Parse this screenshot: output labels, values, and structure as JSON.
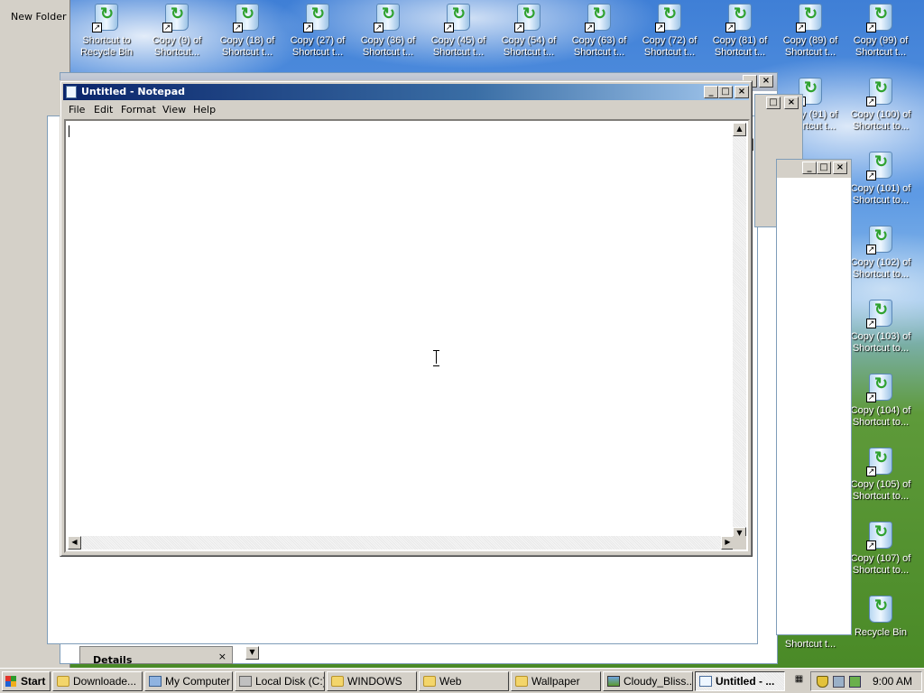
{
  "desktop": {
    "new_folder_label": "New Folder",
    "top_icons": [
      {
        "line1": "Shortcut to",
        "line2": "Recycle Bin"
      },
      {
        "line1": "Copy (9) of",
        "line2": "Shortcut..."
      },
      {
        "line1": "Copy (18) of",
        "line2": "Shortcut t..."
      },
      {
        "line1": "Copy (27) of",
        "line2": "Shortcut t..."
      },
      {
        "line1": "Copy (36) of",
        "line2": "Shortcut t..."
      },
      {
        "line1": "Copy (45) of",
        "line2": "Shortcut t..."
      },
      {
        "line1": "Copy (54) of",
        "line2": "Shortcut t..."
      },
      {
        "line1": "Copy (63) of",
        "line2": "Shortcut t..."
      },
      {
        "line1": "Copy (72) of",
        "line2": "Shortcut t..."
      },
      {
        "line1": "Copy (81) of",
        "line2": "Shortcut t..."
      },
      {
        "line1": "Copy (89) of",
        "line2": "Shortcut t..."
      },
      {
        "line1": "Copy (99) of",
        "line2": "Shortcut t..."
      }
    ],
    "right_icons": [
      {
        "line1": "Copy (91) of",
        "line2": "Shortcut t..."
      },
      {
        "line1": "Copy (100) of",
        "line2": "Shortcut to..."
      },
      {
        "line1": "Copy (101) of",
        "line2": "Shortcut to..."
      },
      {
        "line1": "Copy (102) of",
        "line2": "Shortcut to..."
      },
      {
        "line1": "Copy (103) of",
        "line2": "Shortcut to..."
      },
      {
        "line1": "Copy (104) of",
        "line2": "Shortcut to..."
      },
      {
        "line1": "Copy (105) of",
        "line2": "Shortcut to..."
      },
      {
        "line1": "Copy (107) of",
        "line2": "Shortcut to..."
      },
      {
        "line1": "Recycle Bin",
        "line2": ""
      }
    ],
    "bottom_fragment": "Shortcut t...",
    "details_label": "Details"
  },
  "notepad": {
    "title": "Untitled - Notepad",
    "menu": [
      "File",
      "Edit",
      "Format",
      "View",
      "Help"
    ],
    "text": ""
  },
  "window_controls": {
    "minimize": "_",
    "maximize": "□",
    "close": "×"
  },
  "taskbar": {
    "start_label": "Start",
    "buttons": [
      {
        "label": "Downloade...",
        "icon": "folder-icon",
        "active": false
      },
      {
        "label": "My Computer",
        "icon": "computer-icon",
        "active": false
      },
      {
        "label": "Local Disk (C:)",
        "icon": "disk-icon",
        "active": false
      },
      {
        "label": "WINDOWS",
        "icon": "folder-icon",
        "active": false
      },
      {
        "label": "Web",
        "icon": "folder-icon",
        "active": false
      },
      {
        "label": "Wallpaper",
        "icon": "folder-icon",
        "active": false
      },
      {
        "label": "Cloudy_Bliss...",
        "icon": "image-icon",
        "active": false
      },
      {
        "label": "Untitled - ...",
        "icon": "notepad-icon",
        "active": true
      }
    ],
    "clock": "9:00 AM"
  },
  "colors": {
    "title_active": "#0a246a",
    "face": "#d4d0c8"
  }
}
